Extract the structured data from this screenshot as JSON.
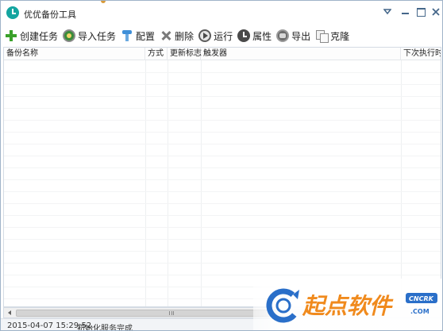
{
  "window": {
    "title": "优优备份工具"
  },
  "toolbar": {
    "items": [
      {
        "label": "创建任务",
        "icon": "plus-icon"
      },
      {
        "label": "导入任务",
        "icon": "import-icon"
      },
      {
        "label": "配置",
        "icon": "config-icon"
      },
      {
        "label": "删除",
        "icon": "delete-icon"
      },
      {
        "label": "运行",
        "icon": "play-icon"
      },
      {
        "label": "属性",
        "icon": "clock-icon"
      },
      {
        "label": "导出",
        "icon": "export-icon"
      },
      {
        "label": "克隆",
        "icon": "clone-icon"
      }
    ]
  },
  "table": {
    "columns": [
      "备份名称",
      "方式",
      "更新标志",
      "触发器",
      "下次执行时间"
    ],
    "rows": []
  },
  "status": {
    "timestamp": "2015-04-07 15:29:52",
    "message": "初始化服务完成"
  },
  "watermark": {
    "text": "起点软件",
    "badge": "CNCRK",
    "domain": ".COM"
  },
  "colors": {
    "accent": "#14a5a0",
    "watermark_blue": "#2a6fc9",
    "watermark_orange": "#f08a1d"
  }
}
